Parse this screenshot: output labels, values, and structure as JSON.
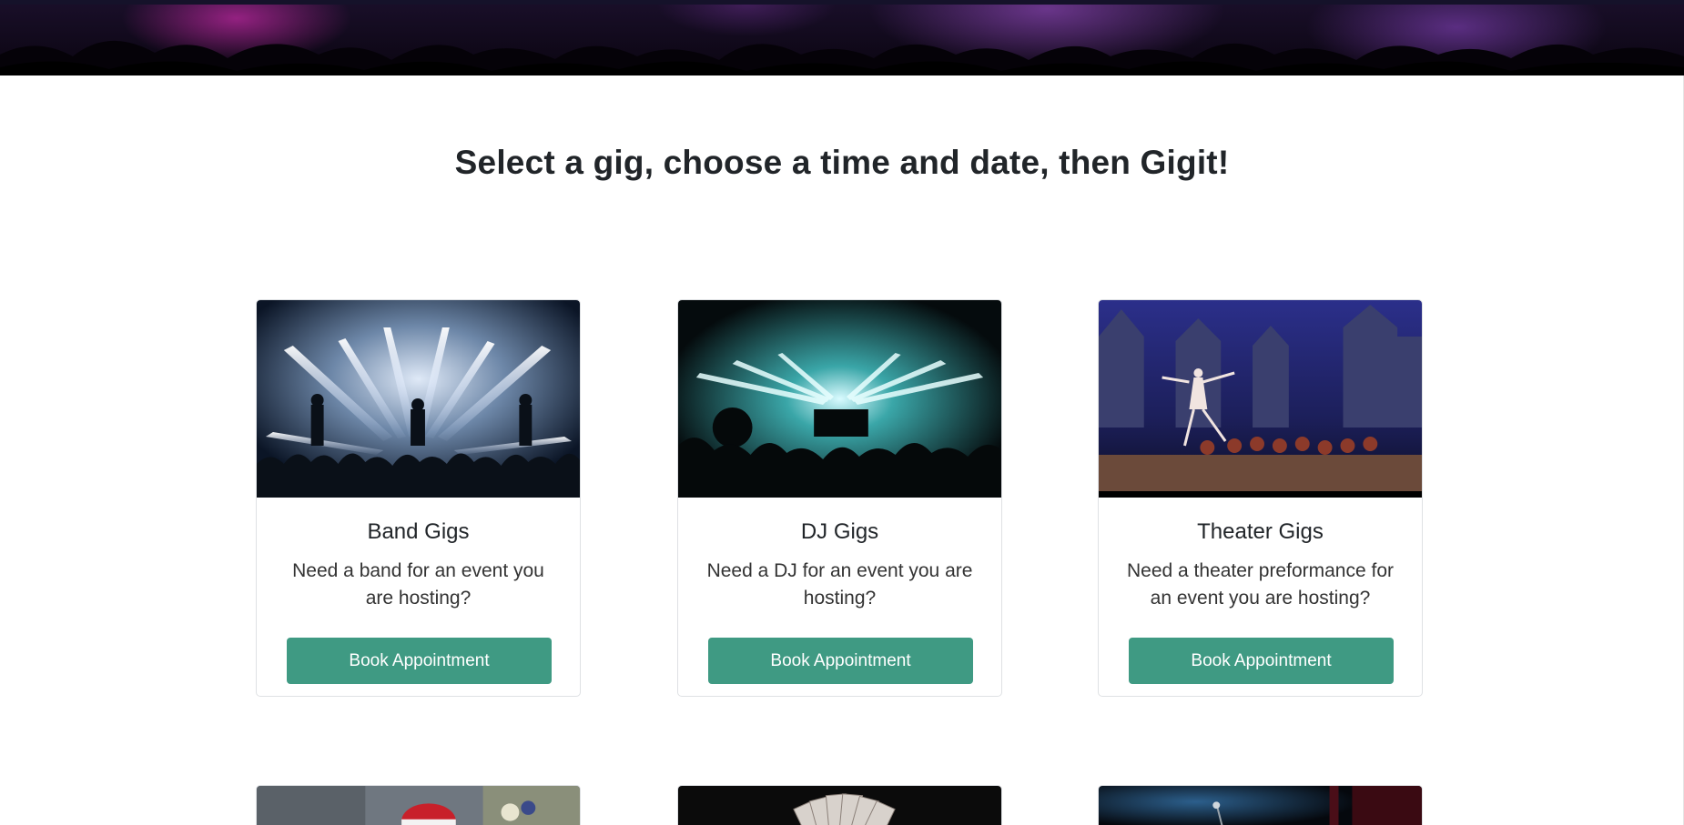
{
  "page": {
    "heading": "Select a gig, choose a time and date, then Gigit!"
  },
  "cards": [
    {
      "title": "Band Gigs",
      "text": "Need a band for an event you are hosting?",
      "button": "Book Appointment",
      "image_icon": "concert-band-photo"
    },
    {
      "title": "DJ Gigs",
      "text": "Need a DJ for an event you are hosting?",
      "button": "Book Appointment",
      "image_icon": "dj-stage-photo"
    },
    {
      "title": "Theater Gigs",
      "text": "Need a theater preformance for an event you are hosting?",
      "button": "Book Appointment",
      "image_icon": "ballet-theater-photo"
    }
  ],
  "partial_cards": [
    {
      "image_icon": "santa-photo"
    },
    {
      "image_icon": "magician-cards-photo"
    },
    {
      "image_icon": "stage-microphone-photo"
    }
  ],
  "colors": {
    "button": "#3f9a83",
    "heading": "#212529",
    "banner": "#1a0f2a"
  }
}
